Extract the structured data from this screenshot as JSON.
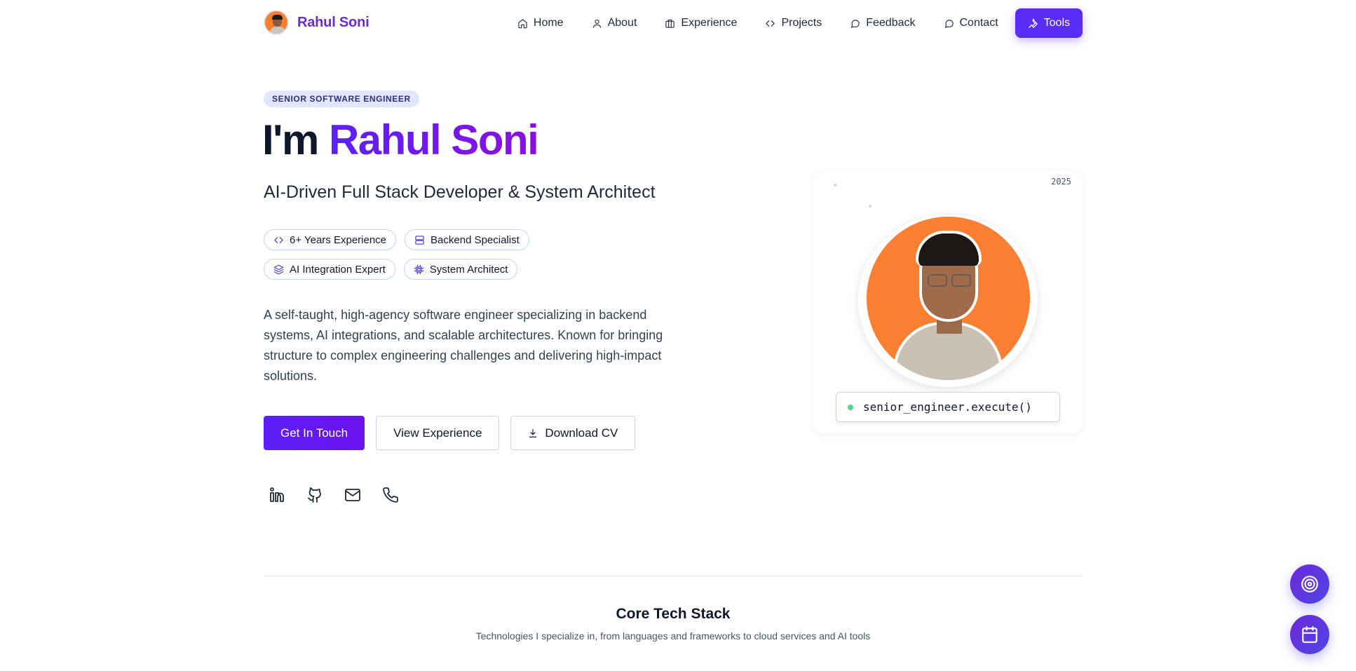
{
  "header": {
    "brand_name": "Rahul Soni",
    "nav": [
      {
        "label": "Home",
        "icon": "home-icon"
      },
      {
        "label": "About",
        "icon": "user-icon"
      },
      {
        "label": "Experience",
        "icon": "briefcase-icon"
      },
      {
        "label": "Projects",
        "icon": "code-icon"
      },
      {
        "label": "Feedback",
        "icon": "message-icon"
      },
      {
        "label": "Contact",
        "icon": "message-icon"
      },
      {
        "label": "Tools",
        "icon": "wrench-icon"
      }
    ]
  },
  "hero": {
    "badge": "SENIOR SOFTWARE ENGINEER",
    "title_prefix": "I'm ",
    "title_name": "Rahul Soni",
    "subtitle": "AI-Driven Full Stack Developer & System Architect",
    "chips": [
      {
        "label": "6+ Years Experience",
        "icon": "code-icon"
      },
      {
        "label": "Backend Specialist",
        "icon": "server-icon"
      },
      {
        "label": "AI Integration Expert",
        "icon": "layers-icon"
      },
      {
        "label": "System Architect",
        "icon": "cpu-icon"
      }
    ],
    "description": "A self-taught, high-agency software engineer specializing in backend systems, AI integrations, and scalable architectures. Known for bringing structure to complex engineering challenges and delivering high-impact solutions.",
    "buttons": {
      "get_in_touch": "Get In Touch",
      "view_experience": "View Experience",
      "download_cv": "Download CV"
    },
    "socials": [
      "linkedin-icon",
      "github-icon",
      "mail-icon",
      "phone-icon"
    ]
  },
  "profile_card": {
    "year": "2025",
    "command": "senior_engineer.execute()"
  },
  "tech_stack": {
    "title": "Core Tech Stack",
    "subtitle": "Technologies I specialize in, from languages and frameworks to cloud services and AI tools"
  },
  "colors": {
    "accent": "#5b2cf5",
    "accent_gradient_end": "#8b10e0",
    "status_dot": "#4ade80",
    "photo_bg": "#fb7f32"
  }
}
